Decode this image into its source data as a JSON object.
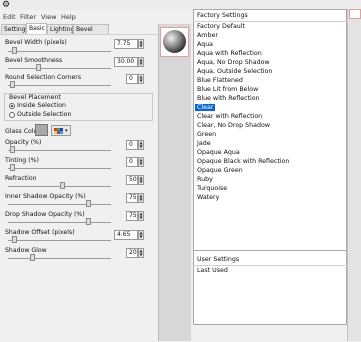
{
  "app": {
    "icon_glyph": "⚙"
  },
  "menu": {
    "items": [
      "Edit",
      "Filter",
      "View",
      "Help"
    ]
  },
  "tabs": [
    "Settings",
    "Basic",
    "Lighting",
    "Bevel Profile"
  ],
  "active_tab": "Basic",
  "controls": {
    "bevel_width": {
      "label": "Bevel Width (pixels)",
      "value": "7.75",
      "slider_level": 0.05
    },
    "bevel_smoothness": {
      "label": "Bevel Smoothness",
      "value": "30.00",
      "slider_level": 0.25
    },
    "round_corners": {
      "label": "Round Selection Corners",
      "value": "0",
      "slider_level": 0.02
    },
    "bevel_placement": {
      "label": "Bevel Placement",
      "options": [
        "Inside Selection",
        "Outside Selection"
      ],
      "selected": "Inside Selection"
    },
    "glass_color": {
      "label": "Glass Color",
      "swatch": "#a9a9a9"
    },
    "opacity": {
      "label": "Opacity (%)",
      "value": "0",
      "slider_level": 0.02
    },
    "tinting": {
      "label": "Tinting (%)",
      "value": "0",
      "slider_level": 0.02
    },
    "refraction": {
      "label": "Refraction",
      "value": "50",
      "slider_level": 0.5
    },
    "inner_shadow_opacity": {
      "label": "Inner Shadow Opacity (%)",
      "value": "75",
      "slider_level": 0.75
    },
    "drop_shadow_opacity": {
      "label": "Drop Shadow Opacity (%)",
      "value": "75",
      "slider_level": 0.75
    },
    "shadow_offset": {
      "label": "Shadow Offset (pixels)",
      "value": "4.65",
      "slider_level": 0.05
    },
    "shadow_glow": {
      "label": "Shadow Glow",
      "value": "20",
      "slider_level": 0.2
    }
  },
  "factory_settings": {
    "header": "Factory Settings",
    "items": [
      "Factory Default",
      "Amber",
      "Aqua",
      "Aqua with Reflection",
      "Aqua, No Drop Shadow",
      "Aqua, Outside Selection",
      "Blue Flattened",
      "Blue Lit from Below",
      "Blue with Reflection",
      "Clear",
      "Clear with Reflection",
      "Clear, No Drop Shadow",
      "Green",
      "Jade",
      "Opaque Aqua",
      "Opaque Black with Reflection",
      "Opaque Green",
      "Ruby",
      "Turquoise",
      "Watery"
    ],
    "selected": "Clear"
  },
  "user_settings": {
    "header": "User Settings",
    "items": [
      "Last Used"
    ]
  },
  "colors": {
    "selection": "#0a64d0",
    "preview_border": "#e1a0a0"
  }
}
